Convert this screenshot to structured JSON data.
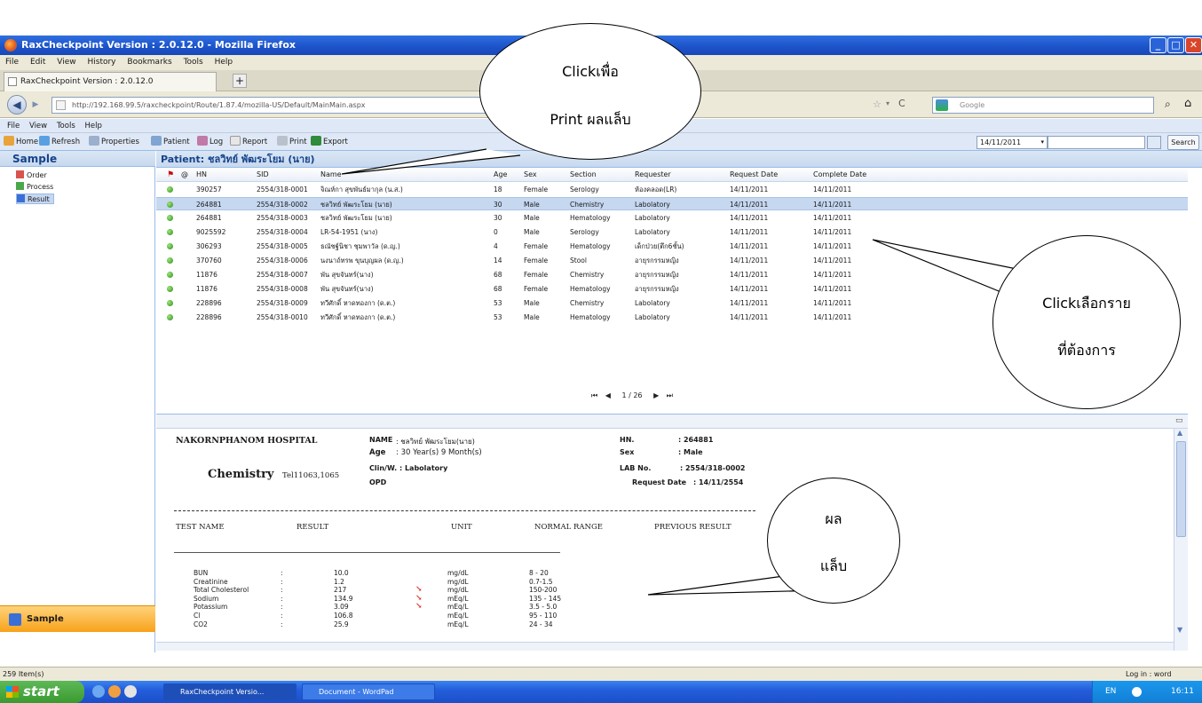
{
  "window": {
    "title": "RaxCheckpoint Version : 2.0.12.0 - Mozilla Firefox"
  },
  "browser_menu": [
    "File",
    "Edit",
    "View",
    "History",
    "Bookmarks",
    "Tools",
    "Help"
  ],
  "tab": {
    "title": "RaxCheckpoint Version : 2.0.12.0",
    "new_tab": "+"
  },
  "url": "http://192.168.99.5/raxcheckpoint/Route/1.87.4/mozilla-US/Default/MainMain.aspx",
  "search_placeholder": "Google",
  "app_menu": [
    "File",
    "View",
    "Tools",
    "Help"
  ],
  "toolbar": {
    "home": "Home",
    "refresh": "Refresh",
    "properties": "Properties",
    "patient": "Patient",
    "log": "Log",
    "report": "Report",
    "print": "Print",
    "export": "Export",
    "date": "14/11/2011",
    "search": "Search"
  },
  "sidebar": {
    "title": "Sample",
    "items": [
      "Order",
      "Process",
      "Result"
    ],
    "footer": "Sample"
  },
  "patient_title": "Patient: ชลวิทย์ พัฒระโยม (นาย)",
  "grid": {
    "headers": [
      "HN",
      "SID",
      "Name",
      "Age",
      "Sex",
      "Section",
      "Requester",
      "Request Date",
      "Complete Date"
    ],
    "rows": [
      [
        "390257",
        "2554/318-0001",
        "จิณห์กา สุขพันธ์มากุล (น.ส.)",
        "18",
        "Female",
        "Serology",
        "ห้องคลอด(LR)",
        "14/11/2011",
        "14/11/2011"
      ],
      [
        "264881",
        "2554/318-0002",
        "ชลวิทย์ พัฒระโยม (นาย)",
        "30",
        "Male",
        "Chemistry",
        "Labolatory",
        "14/11/2011",
        "14/11/2011"
      ],
      [
        "264881",
        "2554/318-0003",
        "ชลวิทย์ พัฒระโยม (นาย)",
        "30",
        "Male",
        "Hematology",
        "Labolatory",
        "14/11/2011",
        "14/11/2011"
      ],
      [
        "9025592",
        "2554/318-0004",
        "LR-54-1951 (นาง)",
        "0",
        "Male",
        "Serology",
        "Labolatory",
        "14/11/2011",
        "14/11/2011"
      ],
      [
        "306293",
        "2554/318-0005",
        "ธณัชฐ์นิชา ชุมพาวัล (ด.ญ.)",
        "4",
        "Female",
        "Hematology",
        "เด็กป่วย(ตึก6ชั้น)",
        "14/11/2011",
        "14/11/2011"
      ],
      [
        "370760",
        "2554/318-0006",
        "นงนาถ์ทรพ ขุนบุญผล (ด.ญ.)",
        "14",
        "Female",
        "Stool",
        "อายุรกรรมหญิง",
        "14/11/2011",
        "14/11/2011"
      ],
      [
        "11876",
        "2554/318-0007",
        "พัน สุขจันทร์(นาง)",
        "68",
        "Female",
        "Chemistry",
        "อายุรกรรมหญิง",
        "14/11/2011",
        "14/11/2011"
      ],
      [
        "11876",
        "2554/318-0008",
        "พัน สุขจันทร์(นาง)",
        "68",
        "Female",
        "Hematology",
        "อายุรกรรมหญิง",
        "14/11/2011",
        "14/11/2011"
      ],
      [
        "228896",
        "2554/318-0009",
        "ทวีศักดิ์ หาดทองกา (ด.ต.)",
        "53",
        "Male",
        "Chemistry",
        "Labolatory",
        "14/11/2011",
        "14/11/2011"
      ],
      [
        "228896",
        "2554/318-0010",
        "ทวีศักดิ์ หาดทองกา (ด.ต.)",
        "53",
        "Male",
        "Hematology",
        "Labolatory",
        "14/11/2011",
        "14/11/2011"
      ]
    ],
    "pager": "1 / 26"
  },
  "report": {
    "hospital": "NAKORNPHANOM HOSPITAL",
    "section": "Chemistry",
    "tel": "Tel11063,1065",
    "name_label": "NAME",
    "name": ": ชลวิทย์ พัฒระโยม(นาย)",
    "age_label": "Age",
    "age": ": 30 Year(s) 9 Month(s)",
    "clin_label": "Clin/W. : Labolatory",
    "opd": "OPD",
    "hn_label": "HN.",
    "hn": ": 264881",
    "sex_label": "Sex",
    "sex": ": Male",
    "lab_label": "LAB No.",
    "lab": ": 2554/318-0002",
    "req_label": "Request Date",
    "req": ": 14/11/2554",
    "col_headers": [
      "TEST NAME",
      "RESULT",
      "UNIT",
      "NORMAL RANGE",
      "PREVIOUS RESULT"
    ],
    "tests": [
      [
        "BUN",
        ":",
        "10.0",
        "mg/dL",
        "8 - 20"
      ],
      [
        "Creatinine",
        ":",
        "1.2",
        "mg/dL",
        "0.7-1.5"
      ],
      [
        "Total Cholesterol",
        ":",
        "217",
        "mg/dL",
        "150-200"
      ],
      [
        "Sodium",
        ":",
        "134.9",
        "mEq/L",
        "135 - 145"
      ],
      [
        "Potassium",
        ":",
        "3.09",
        "mEq/L",
        "3.5 - 5.0"
      ],
      [
        "Cl",
        ":",
        "106.8",
        "mEq/L",
        "95 - 110"
      ],
      [
        "CO2",
        ":",
        "25.9",
        "mEq/L",
        "24 - 34"
      ]
    ]
  },
  "status": {
    "items": "259 Item(s)",
    "login": "Log in : word"
  },
  "taskbar": {
    "start": "start",
    "tasks": [
      "RaxCheckpoint Versio...",
      "Document - WordPad"
    ],
    "lang": "EN",
    "clock": "16:11"
  },
  "callouts": {
    "print_line1": "Clickเพื่อ",
    "print_line2": "Print ผลแล็บ",
    "select_line1": "Clickเลือกราย",
    "select_line2": "ที่ต้องการ",
    "result_line1": "ผล",
    "result_line2": "แล็บ"
  }
}
